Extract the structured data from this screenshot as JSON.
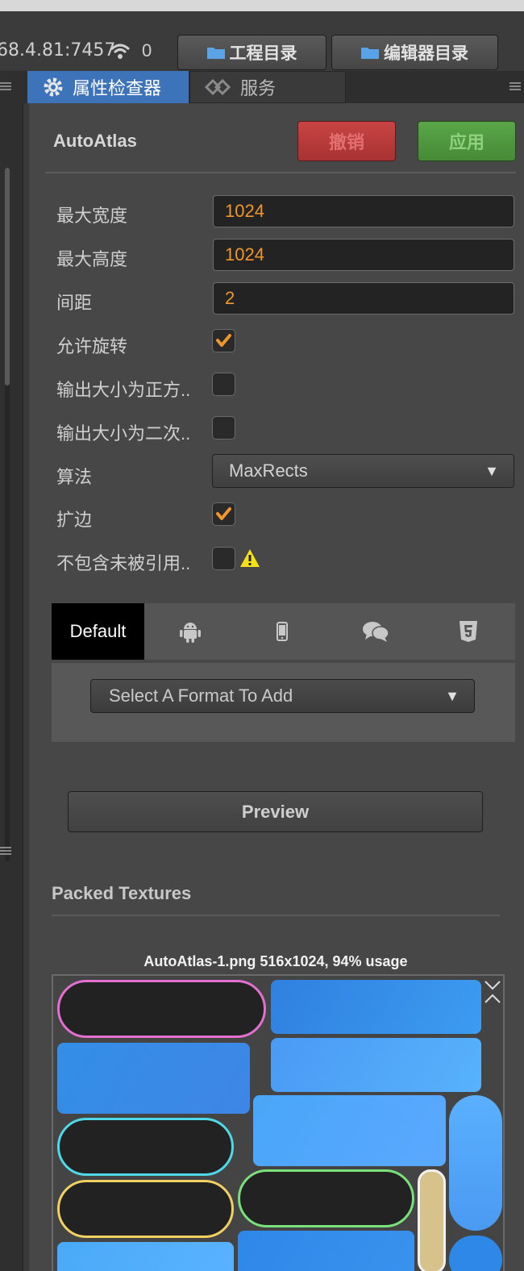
{
  "topbar": {
    "ip_text": "68.4.81:7457",
    "device_count": "0",
    "project_dir_button": "工程目录",
    "editor_dir_button": "编辑器目录"
  },
  "tabs": [
    {
      "label": "属性检查器",
      "icon": "gear-icon",
      "active": true
    },
    {
      "label": "服务",
      "icon": "link-icon",
      "active": false
    }
  ],
  "inspector": {
    "title": "AutoAtlas",
    "revert_button": "撤销",
    "apply_button": "应用",
    "colors": {
      "revert": "#c43a3a",
      "apply": "#4f9a3d",
      "accent_value": "#f0962c"
    },
    "properties": {
      "max_width": {
        "label": "最大宽度",
        "value": "1024"
      },
      "max_height": {
        "label": "最大高度",
        "value": "1024"
      },
      "padding": {
        "label": "间距",
        "value": "2"
      },
      "allow_rotation": {
        "label": "允许旋转",
        "checked": true
      },
      "force_squared": {
        "label": "输出大小为正方..",
        "checked": false
      },
      "power_of_two": {
        "label": "输出大小为二次..",
        "checked": false
      },
      "algorithm": {
        "label": "算法",
        "value": "MaxRects"
      },
      "bleeding": {
        "label": "扩边",
        "checked": true
      },
      "filter_unused": {
        "label": "不包含未被引用..",
        "checked": false,
        "warning": true
      }
    },
    "platform_tabs": {
      "default_label": "Default",
      "icons": [
        "android-icon",
        "mobile-icon",
        "chat-icon",
        "html5-icon"
      ]
    },
    "format_select": "Select A Format To Add",
    "preview_button": "Preview",
    "packed_textures_title": "Packed Textures",
    "atlas_caption": "AutoAtlas-1.png 516x1024, 94% usage"
  }
}
